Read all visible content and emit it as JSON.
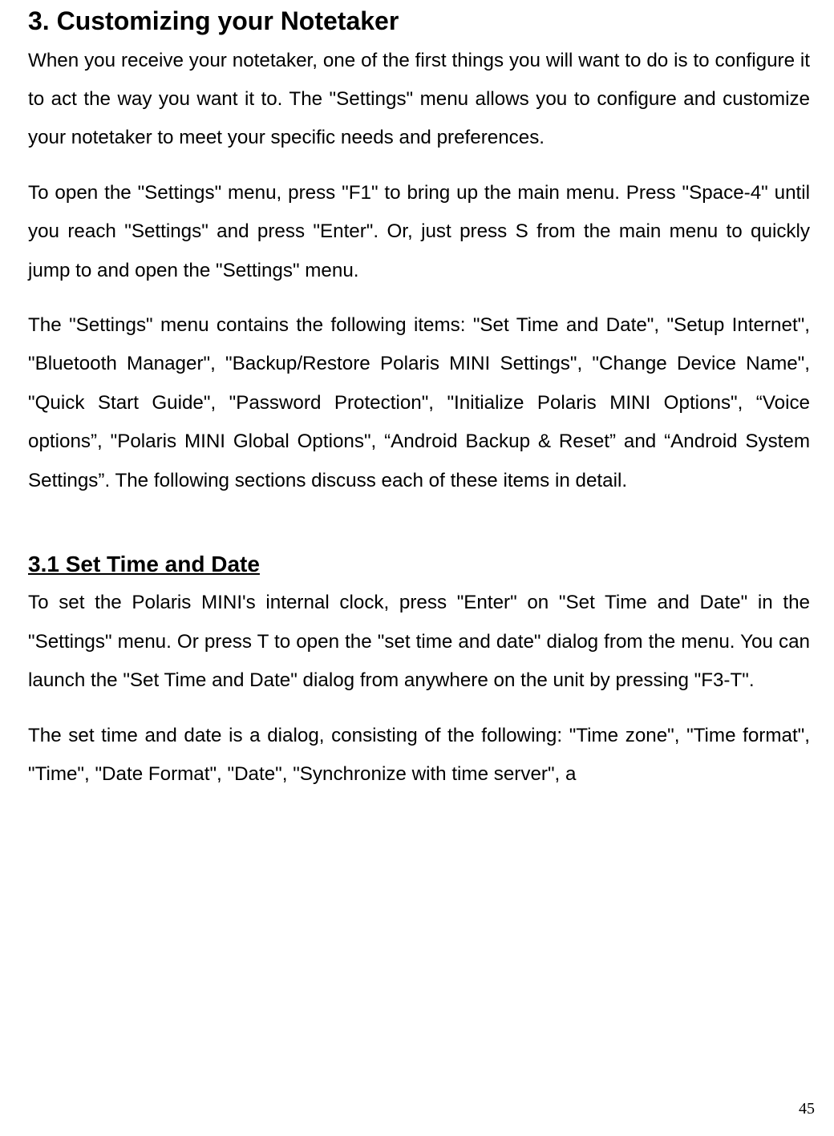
{
  "heading": "3. Customizing your Notetaker",
  "paragraphs": {
    "p1": "When you receive your notetaker, one of the first things you will want to do is to configure it to act the way you want it to. The \"Settings\" menu allows you to configure and customize your notetaker to meet your specific needs and preferences.",
    "p2": "To open the \"Settings\" menu, press \"F1\" to bring up the main menu. Press \"Space-4\" until you reach \"Settings\" and press \"Enter\". Or, just press S from the main menu to quickly jump to and open the \"Settings\" menu.",
    "p3": "The \"Settings\" menu contains the following items: \"Set Time and Date\", \"Setup Internet\", \"Bluetooth Manager\", \"Backup/Restore Polaris MINI Settings\", \"Change Device Name\", \"Quick Start Guide\", \"Password Protection\", \"Initialize Polaris MINI Options\", “Voice options”, \"Polaris MINI Global Options\", “Android Backup & Reset” and “Android System Settings”. The following sections discuss each of these items in detail."
  },
  "subheading": "3.1 Set Time and Date",
  "sub_paragraphs": {
    "sp1": "To set the Polaris MINI's internal clock, press \"Enter\" on \"Set Time and Date\" in the \"Settings\" menu. Or press T to open the \"set time and date\" dialog from the menu. You can launch the \"Set Time and Date\" dialog from anywhere on the unit by pressing \"F3-T\".",
    "sp2": "The set time and date is a dialog, consisting of the following: \"Time zone\", \"Time format\", \"Time\", \"Date Format\", \"Date\", \"Synchronize with time server\", a"
  },
  "page_number": "45"
}
